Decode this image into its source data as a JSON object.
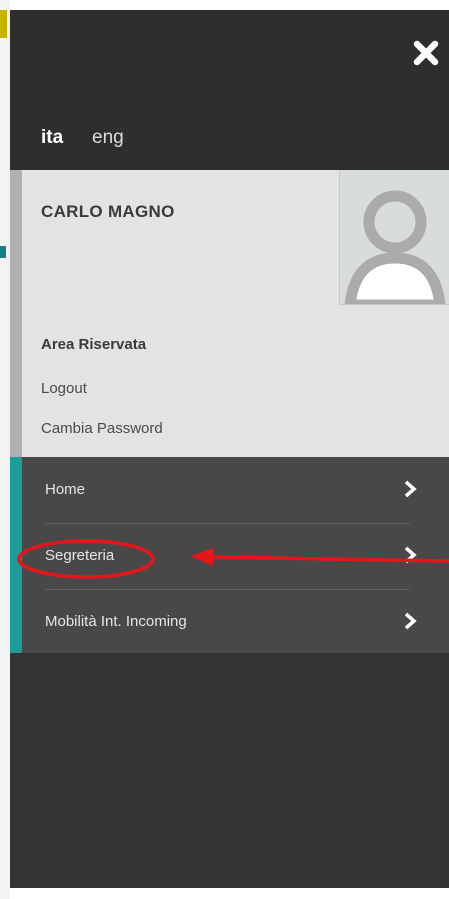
{
  "language_switcher": {
    "active": "ita",
    "inactive": "eng"
  },
  "user": {
    "name": "CARLO MAGNO"
  },
  "area": {
    "title": "Area Riservata",
    "links": [
      "Logout",
      "Cambia Password"
    ]
  },
  "menu": {
    "items": [
      {
        "label": "Home",
        "icon": "chevron-right-icon"
      },
      {
        "label": "Segreteria",
        "icon": "chevron-right-icon"
      },
      {
        "label": "Mobilità Int. Incoming",
        "icon": "chevron-right-icon"
      }
    ]
  },
  "colors": {
    "drawer_bg": "#333333",
    "menu_bg": "#484848",
    "accent_teal": "#1a9c97",
    "user_panel_bg": "#e3e3e3",
    "annotation_red": "#e8141b"
  },
  "icons": {
    "close": "close-icon",
    "avatar": "avatar-icon"
  }
}
